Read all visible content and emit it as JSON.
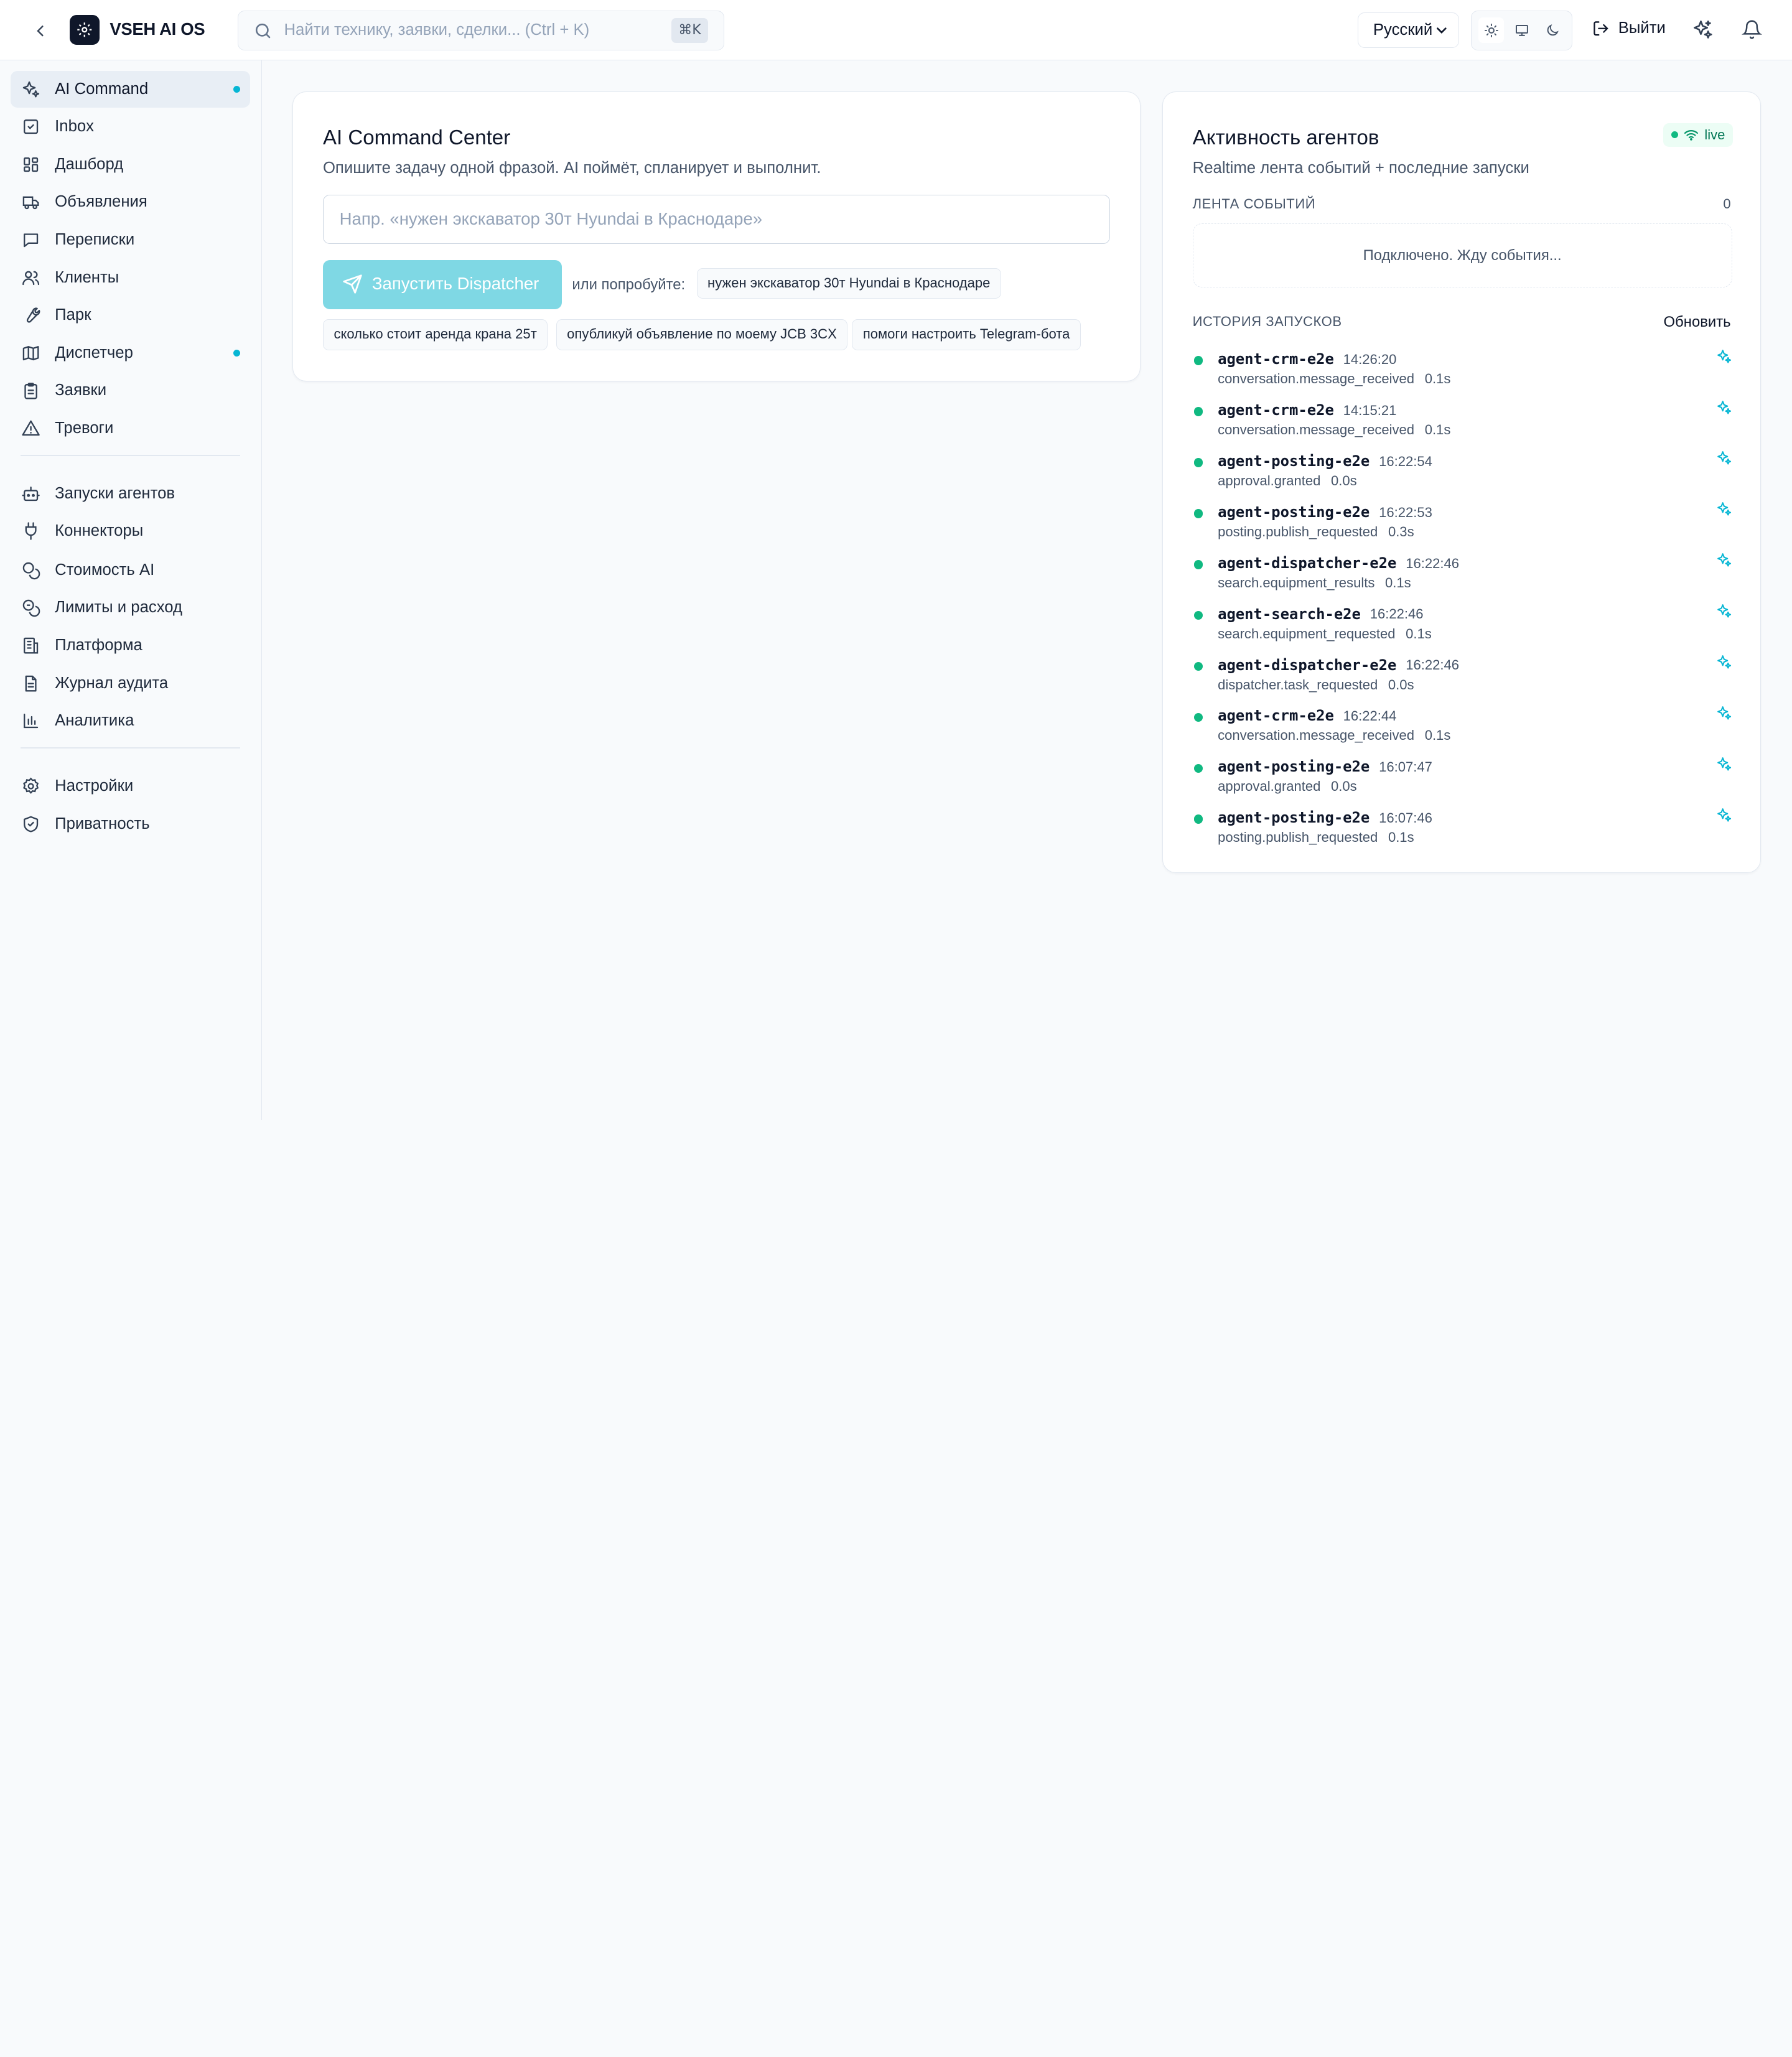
{
  "header": {
    "app_name": "VSEH AI OS",
    "search_placeholder": "Найти технику, заявки, сделки... (Ctrl + K)",
    "search_shortcut": "⌘K",
    "language": "Русский",
    "logout_label": "Выйти"
  },
  "sidebar": {
    "group1": [
      {
        "label": "AI Command",
        "icon": "sparkles-icon",
        "active": true,
        "dot": true
      },
      {
        "label": "Inbox",
        "icon": "inbox-check-icon"
      },
      {
        "label": "Дашборд",
        "icon": "dashboard-grid-icon"
      },
      {
        "label": "Объявления",
        "icon": "truck-icon"
      },
      {
        "label": "Переписки",
        "icon": "message-square-icon"
      },
      {
        "label": "Клиенты",
        "icon": "users-icon"
      },
      {
        "label": "Парк",
        "icon": "wrench-icon"
      },
      {
        "label": "Диспетчер",
        "icon": "map-icon",
        "dot": true
      },
      {
        "label": "Заявки",
        "icon": "clipboard-icon"
      },
      {
        "label": "Тревоги",
        "icon": "alert-triangle-icon"
      }
    ],
    "group2": [
      {
        "label": "Запуски агентов",
        "icon": "bot-icon"
      },
      {
        "label": "Коннекторы",
        "icon": "plug-icon"
      },
      {
        "label": "Стоимость AI",
        "icon": "coins-icon"
      },
      {
        "label": "Лимиты и расход",
        "icon": "coins-limit-icon"
      },
      {
        "label": "Платформа",
        "icon": "building-icon"
      },
      {
        "label": "Журнал аудита",
        "icon": "file-text-icon"
      },
      {
        "label": "Аналитика",
        "icon": "bar-chart-icon"
      }
    ],
    "group3": [
      {
        "label": "Настройки",
        "icon": "gear-icon"
      },
      {
        "label": "Приватность",
        "icon": "shield-check-icon"
      }
    ]
  },
  "command": {
    "title": "AI Command Center",
    "subtitle": "Опишите задачу одной фразой. AI поймёт, спланирует и выполнит.",
    "input_placeholder": "Напр. «нужен экскаватор 30т Hyundai в Краснодаре»",
    "run_label": "Запустить Dispatcher",
    "try_label": "или попробуйте:",
    "suggestions": [
      "нужен экскаватор 30т Hyundai в Краснодаре",
      "сколько стоит аренда крана 25т",
      "опубликуй объявление по моему JCB 3CX",
      "помоги настроить Telegram-бота"
    ]
  },
  "activity": {
    "title": "Активность агентов",
    "badge": "live",
    "subtitle": "Realtime лента событий + последние запуски",
    "feed_title": "ЛЕНТА СОБЫТИЙ",
    "feed_count": "0",
    "feed_empty": "Подключено. Жду события...",
    "history_title": "ИСТОРИЯ ЗАПУСКОВ",
    "refresh_label": "Обновить",
    "runs": [
      {
        "name": "agent-crm-e2e",
        "time": "14:26:20",
        "event": "conversation.message_received",
        "duration": "0.1s"
      },
      {
        "name": "agent-crm-e2e",
        "time": "14:15:21",
        "event": "conversation.message_received",
        "duration": "0.1s"
      },
      {
        "name": "agent-posting-e2e",
        "time": "16:22:54",
        "event": "approval.granted",
        "duration": "0.0s"
      },
      {
        "name": "agent-posting-e2e",
        "time": "16:22:53",
        "event": "posting.publish_requested",
        "duration": "0.3s"
      },
      {
        "name": "agent-dispatcher-e2e",
        "time": "16:22:46",
        "event": "search.equipment_results",
        "duration": "0.1s"
      },
      {
        "name": "agent-search-e2e",
        "time": "16:22:46",
        "event": "search.equipment_requested",
        "duration": "0.1s"
      },
      {
        "name": "agent-dispatcher-e2e",
        "time": "16:22:46",
        "event": "dispatcher.task_requested",
        "duration": "0.0s"
      },
      {
        "name": "agent-crm-e2e",
        "time": "16:22:44",
        "event": "conversation.message_received",
        "duration": "0.1s"
      },
      {
        "name": "agent-posting-e2e",
        "time": "16:07:47",
        "event": "approval.granted",
        "duration": "0.0s"
      },
      {
        "name": "agent-posting-e2e",
        "time": "16:07:46",
        "event": "posting.publish_requested",
        "duration": "0.1s"
      }
    ]
  },
  "colors": {
    "accent": "#06b6d4",
    "run_button": "#7fd8e4",
    "success": "#10b981",
    "ink": "#0f172a"
  }
}
